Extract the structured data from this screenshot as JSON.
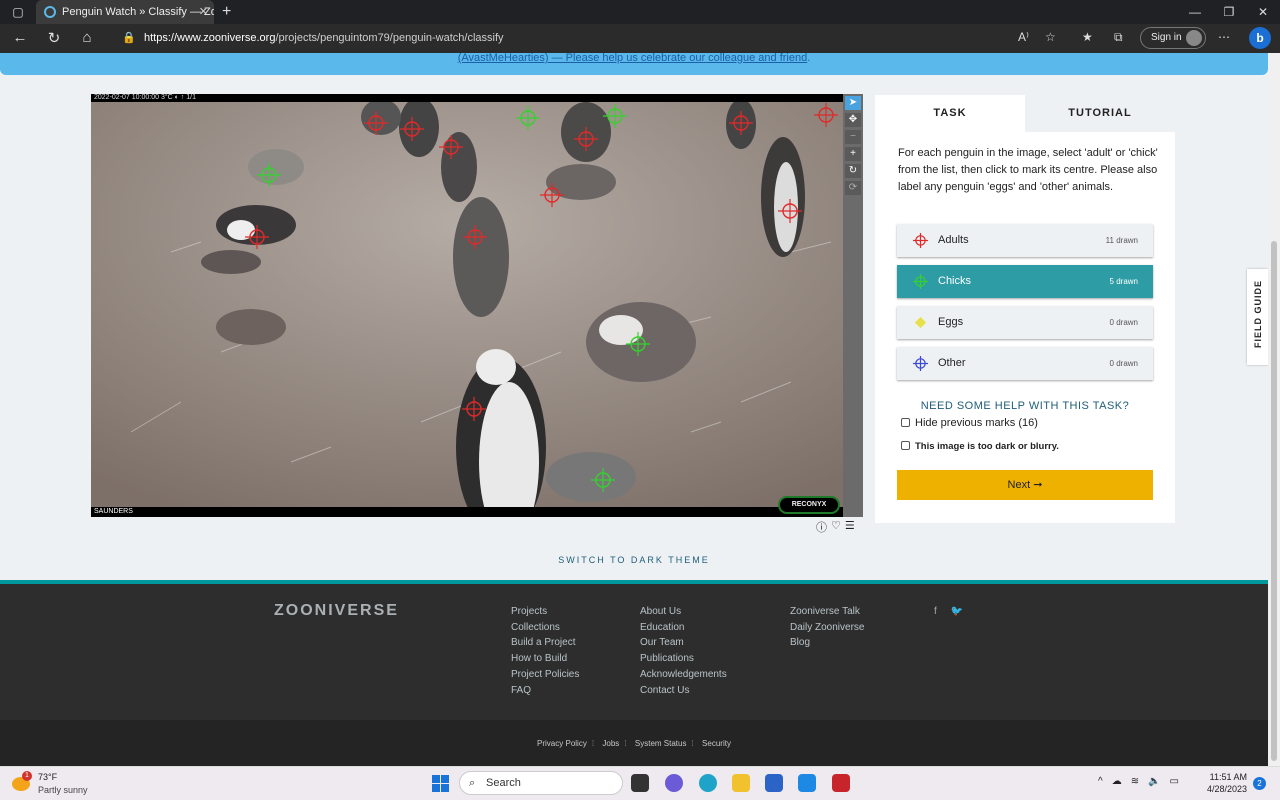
{
  "browser": {
    "tab_title": "Penguin Watch » Classify — Zoo",
    "tab_close": "✕",
    "new_tab": "+",
    "url_host": "https://www.zooniverse.org",
    "url_path": "/projects/penguintom79/penguin-watch/classify",
    "sign_in": "Sign in",
    "window_controls": [
      "—",
      "❐",
      "✕"
    ]
  },
  "banner": {
    "text": "(AvastMeHearties) — Please help us celebrate our colleague and friend"
  },
  "camera": {
    "header": "2022-02-07 10:00:00   3°C ◐   ↑ 1/1",
    "footer": "SAUNDERS",
    "brand": "RECONYX"
  },
  "task_panel": {
    "tabs": [
      {
        "label": "TASK",
        "active": true
      },
      {
        "label": "TUTORIAL",
        "active": false
      }
    ],
    "instructions": "For each penguin in the image, select 'adult' or 'chick' from the list, then click to mark its centre. Please also label any penguin 'eggs' and 'other' animals.",
    "tools": [
      {
        "label": "Adults",
        "count": "11 drawn",
        "color": "#e02a2a",
        "selected": false
      },
      {
        "label": "Chicks",
        "count": "5 drawn",
        "color": "#36d12f",
        "selected": true
      },
      {
        "label": "Eggs",
        "count": "0 drawn",
        "color": "#e6e04a",
        "selected": false
      },
      {
        "label": "Other",
        "count": "0 drawn",
        "color": "#3b48d6",
        "selected": false
      }
    ],
    "help_link": "NEED SOME HELP WITH THIS TASK?",
    "hide_marks": "Hide previous marks (16)",
    "too_dark": "This image is too dark or blurry.",
    "next_button": "Next ➞"
  },
  "field_guide": "FIELD GUIDE",
  "switch_theme": "SWITCH TO DARK THEME",
  "footer": {
    "logo": "ZOONIVERSE",
    "col1": [
      "Projects",
      "Collections",
      "Build a Project",
      "How to Build",
      "Project Policies",
      "FAQ"
    ],
    "col2": [
      "About Us",
      "Education",
      "Our Team",
      "Publications",
      "Acknowledgements",
      "Contact Us"
    ],
    "col3": [
      "Zooniverse Talk",
      "Daily Zooniverse",
      "Blog"
    ],
    "social": [
      "f",
      "🐦"
    ],
    "bottom_links": [
      "Privacy Policy",
      "Jobs",
      "System Status",
      "Security"
    ]
  },
  "taskbar": {
    "weather_temp": "73°F",
    "weather_desc": "Partly sunny",
    "weather_badge": "1",
    "search_label": "Search",
    "time": "11:51 AM",
    "date": "4/28/2023",
    "notifications": "2"
  },
  "colors": {
    "accent_teal": "#2d9ca4",
    "next_yellow": "#efb100",
    "banner_blue": "#5ab8ea"
  }
}
